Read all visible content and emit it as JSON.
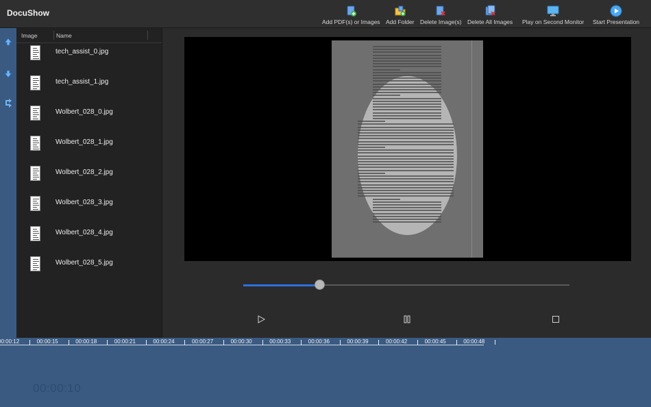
{
  "app": {
    "title": "DocuShow"
  },
  "toolbar": {
    "buttons": [
      {
        "id": "add-pdf",
        "label": "Add PDF(s) or Images",
        "icon": "add-pdf-icon"
      },
      {
        "id": "add-folder",
        "label": "Add Folder",
        "icon": "add-folder-icon"
      },
      {
        "id": "delete-images",
        "label": "Delete Image(s)",
        "icon": "delete-image-icon"
      },
      {
        "id": "delete-all",
        "label": "Delete All Images",
        "icon": "delete-all-icon"
      },
      {
        "id": "second-monitor",
        "label": "Play on Second Monitor",
        "icon": "monitor-icon"
      },
      {
        "id": "start-presentation",
        "label": "Start Presentation",
        "icon": "play-circle-icon"
      }
    ]
  },
  "side_strip": {
    "icons": [
      "move-up-icon",
      "move-down-icon",
      "shuffle-icon"
    ]
  },
  "file_list": {
    "columns": {
      "image": "Image",
      "name": "Name"
    },
    "files": [
      {
        "name": "tech_assist_0.jpg"
      },
      {
        "name": "tech_assist_1.jpg"
      },
      {
        "name": "Wolbert_028_0.jpg"
      },
      {
        "name": "Wolbert_028_1.jpg"
      },
      {
        "name": "Wolbert_028_2.jpg"
      },
      {
        "name": "Wolbert_028_3.jpg"
      },
      {
        "name": "Wolbert_028_4.jpg"
      },
      {
        "name": "Wolbert_028_5.jpg"
      }
    ]
  },
  "player": {
    "progress": 0.233,
    "controls": [
      "play-icon",
      "pause-icon",
      "stop-icon"
    ]
  },
  "timeline": {
    "ticks": [
      "00:00:12",
      "00:00:15",
      "00:00:18",
      "00:00:21",
      "00:00:24",
      "00:00:27",
      "00:00:30",
      "00:00:33",
      "00:00:36",
      "00:00:39",
      "00:00:42",
      "00:00:45",
      "00:00:48"
    ],
    "current_time": "00:00:10"
  },
  "colors": {
    "accent": "#2f6fe0",
    "panel_blue": "#3a5a82"
  }
}
